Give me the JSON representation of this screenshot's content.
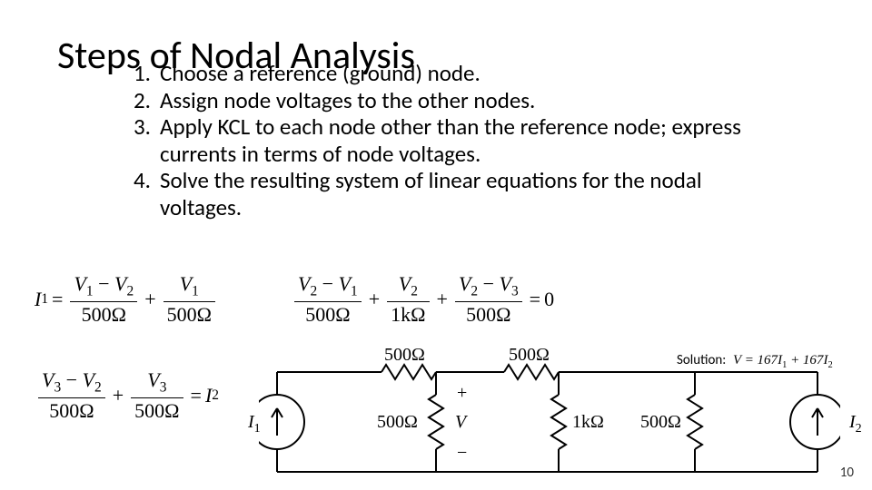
{
  "title": "Steps of Nodal Analysis",
  "steps": [
    {
      "n": "1.",
      "t": "Choose a reference (ground) node."
    },
    {
      "n": "2.",
      "t": "Assign node voltages to the other nodes."
    },
    {
      "n": "3.",
      "t": "Apply KCL to each node other than the reference node; express currents in terms of node voltages."
    },
    {
      "n": "4.",
      "t": "Solve the resulting system of linear equations for the nodal voltages."
    }
  ],
  "equations": {
    "eq1": {
      "lhs": "I",
      "lhs_sub": "1",
      "t1n": "V",
      "t1n_sub": "1",
      "t1n2": "V",
      "t1n2_sub": "2",
      "t1d": "500Ω",
      "t2n": "V",
      "t2n_sub": "1",
      "t2d": "500Ω"
    },
    "eq2": {
      "t1n": "V",
      "t1n_sub": "2",
      "t1n2": "V",
      "t1n2_sub": "1",
      "t1d": "500Ω",
      "t2n": "V",
      "t2n_sub": "2",
      "t2d": "1kΩ",
      "t3n": "V",
      "t3n_sub": "2",
      "t3n2": "V",
      "t3n2_sub": "3",
      "t3d": "500Ω",
      "rhs": "0"
    },
    "eq3": {
      "t1n": "V",
      "t1n_sub": "3",
      "t1n2": "V",
      "t1n2_sub": "2",
      "t1d": "500Ω",
      "t2n": "V",
      "t2n_sub": "3",
      "t2d": "500Ω",
      "rhs": "I",
      "rhs_sub": "2"
    }
  },
  "circuit": {
    "r_top1": "500Ω",
    "r_top2": "500Ω",
    "r_mid1": "500Ω",
    "r_mid2": "1kΩ",
    "r_right": "500Ω",
    "v_label": "V",
    "plus": "+",
    "minus": "−",
    "i1": "I",
    "i1_sub": "1",
    "i2": "I",
    "i2_sub": "2"
  },
  "solution": {
    "label": "Solution:",
    "expr_pre": "V = 167",
    "i1": "I",
    "i1_sub": "1",
    "plus": " + 167",
    "i2": "I",
    "i2_sub": "2"
  },
  "page": "10"
}
